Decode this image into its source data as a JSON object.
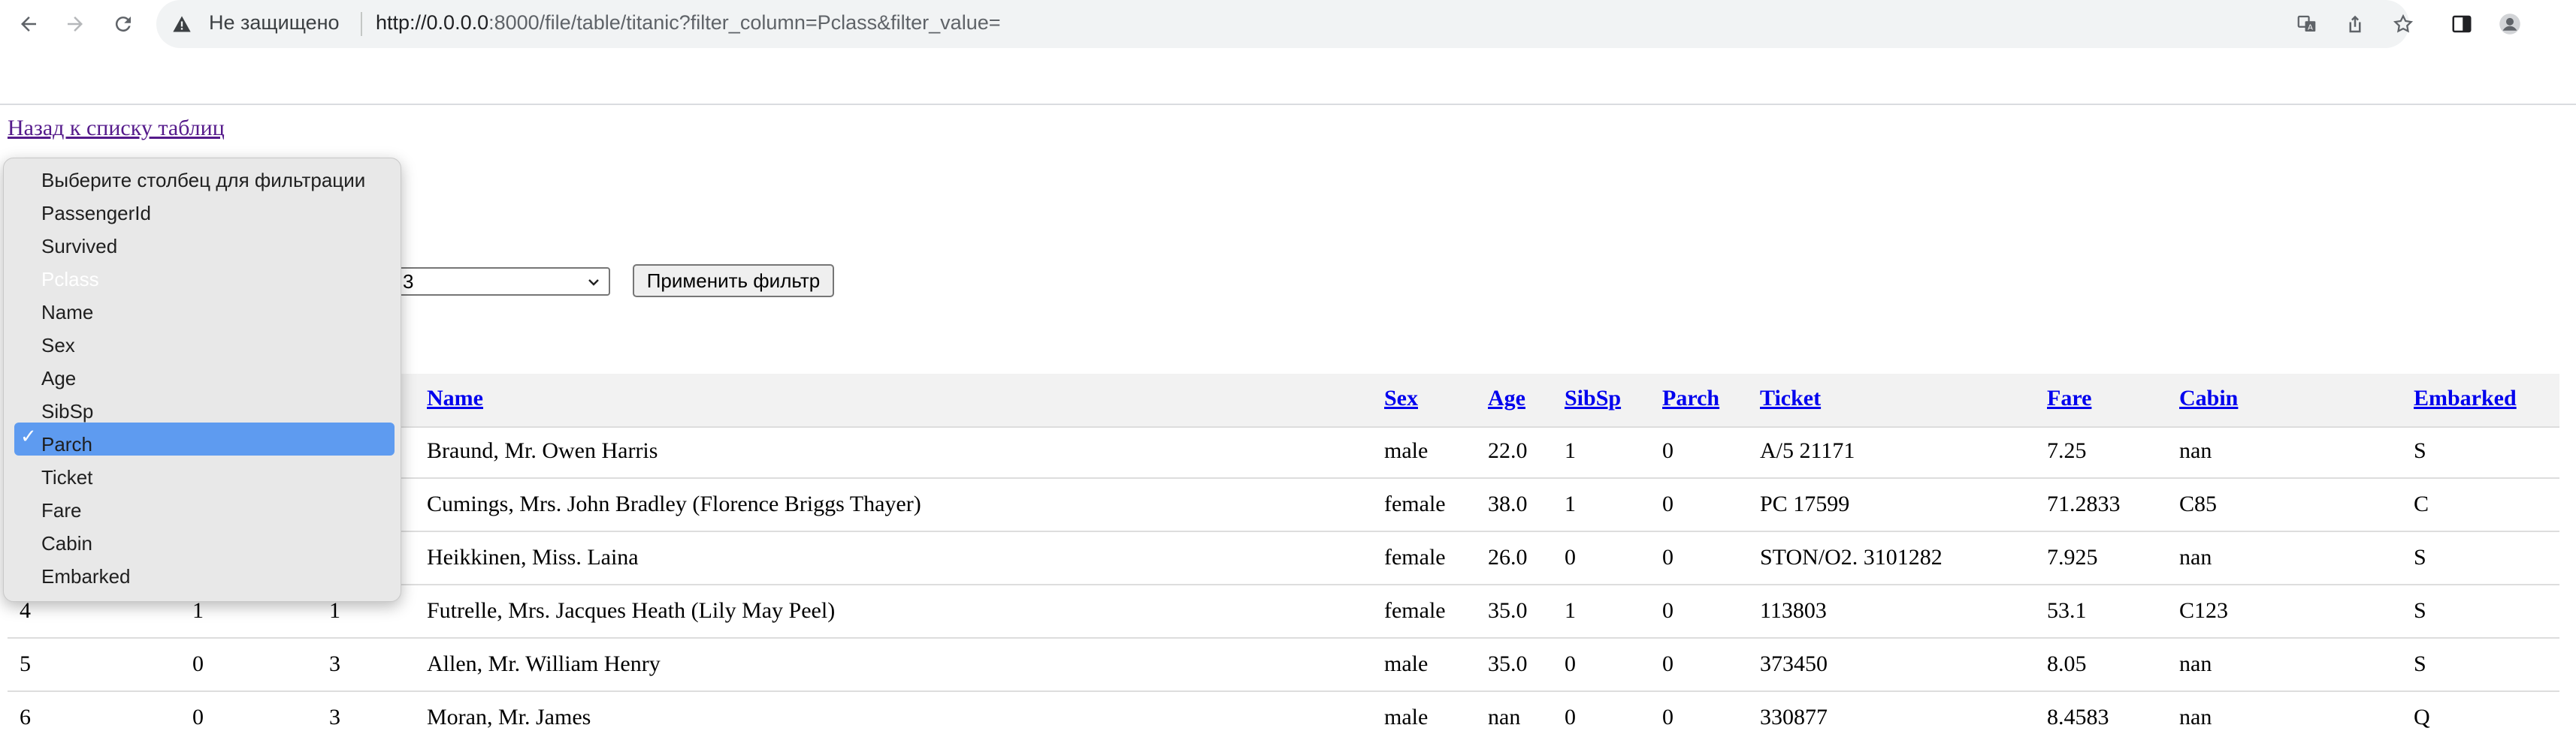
{
  "browser": {
    "security_label": "Не защищено",
    "url_host": "http://0.0.0.0",
    "url_rest": ":8000/file/table/titanic?filter_column=Pclass&filter_value="
  },
  "page": {
    "back_link": "Назад к списку таблиц"
  },
  "filter": {
    "value_selected": "3",
    "apply_label": "Применить фильтр",
    "column_options": [
      "Выберите столбец для фильтрации",
      "PassengerId",
      "Survived",
      "Pclass",
      "Name",
      "Sex",
      "Age",
      "SibSp",
      "Parch",
      "Ticket",
      "Fare",
      "Cabin",
      "Embarked"
    ],
    "selected_index": 3,
    "checkmark": "✓"
  },
  "table": {
    "headers": [
      "Name",
      "Sex",
      "Age",
      "SibSp",
      "Parch",
      "Ticket",
      "Fare",
      "Cabin",
      "Embarked"
    ],
    "rows": [
      {
        "name": "Braund, Mr. Owen Harris",
        "sex": "male",
        "age": "22.0",
        "sibsp": "1",
        "parch": "0",
        "ticket": "A/5 21171",
        "fare": "7.25",
        "cabin": "nan",
        "embarked": "S"
      },
      {
        "name": "Cumings, Mrs. John Bradley (Florence Briggs Thayer)",
        "sex": "female",
        "age": "38.0",
        "sibsp": "1",
        "parch": "0",
        "ticket": "PC 17599",
        "fare": "71.2833",
        "cabin": "C85",
        "embarked": "C"
      },
      {
        "name": "Heikkinen, Miss. Laina",
        "sex": "female",
        "age": "26.0",
        "sibsp": "0",
        "parch": "0",
        "ticket": "STON/O2. 3101282",
        "fare": "7.925",
        "cabin": "nan",
        "embarked": "S"
      },
      {
        "passenger_id": "4",
        "survived": "1",
        "pclass": "1",
        "name": "Futrelle, Mrs. Jacques Heath (Lily May Peel)",
        "sex": "female",
        "age": "35.0",
        "sibsp": "1",
        "parch": "0",
        "ticket": "113803",
        "fare": "53.1",
        "cabin": "C123",
        "embarked": "S"
      },
      {
        "passenger_id": "5",
        "survived": "0",
        "pclass": "3",
        "name": "Allen, Mr. William Henry",
        "sex": "male",
        "age": "35.0",
        "sibsp": "0",
        "parch": "0",
        "ticket": "373450",
        "fare": "8.05",
        "cabin": "nan",
        "embarked": "S"
      },
      {
        "passenger_id": "6",
        "survived": "0",
        "pclass": "3",
        "name": "Moran, Mr. James",
        "sex": "male",
        "age": "nan",
        "sibsp": "0",
        "parch": "0",
        "ticket": "330877",
        "fare": "8.4583",
        "cabin": "nan",
        "embarked": "Q"
      }
    ]
  },
  "colors": {
    "link": "#0000ee",
    "visited_link": "#551a8b",
    "selection": "#5e9bf0"
  }
}
